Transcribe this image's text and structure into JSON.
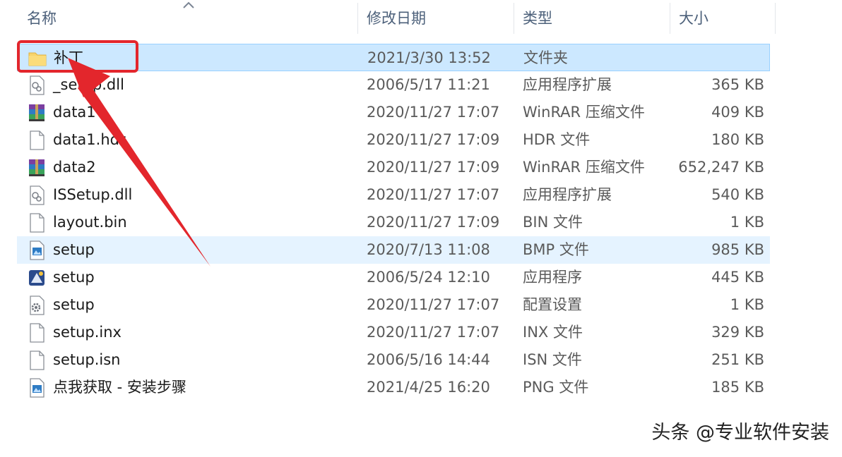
{
  "columns": {
    "name": "名称",
    "date": "修改日期",
    "type": "类型",
    "size": "大小"
  },
  "files": [
    {
      "name": "补丁",
      "date": "2021/3/30 13:52",
      "type": "文件夹",
      "size": "",
      "icon": "folder-icon"
    },
    {
      "name": "_setup.dll",
      "date": "2006/5/17 11:21",
      "type": "应用程序扩展",
      "size": "365 KB",
      "icon": "dll-file-icon"
    },
    {
      "name": "data1",
      "date": "2020/11/27 17:07",
      "type": "WinRAR 压缩文件",
      "size": "409 KB",
      "icon": "winrar-archive-icon"
    },
    {
      "name": "data1.hdr",
      "date": "2020/11/27 17:09",
      "type": "HDR 文件",
      "size": "180 KB",
      "icon": "blank-file-icon"
    },
    {
      "name": "data2",
      "date": "2020/11/27 17:09",
      "type": "WinRAR 压缩文件",
      "size": "652,247 KB",
      "icon": "winrar-archive-icon"
    },
    {
      "name": "ISSetup.dll",
      "date": "2020/11/27 17:07",
      "type": "应用程序扩展",
      "size": "540 KB",
      "icon": "dll-file-icon"
    },
    {
      "name": "layout.bin",
      "date": "2020/11/27 17:09",
      "type": "BIN 文件",
      "size": "1 KB",
      "icon": "blank-file-icon"
    },
    {
      "name": "setup",
      "date": "2020/7/13 11:08",
      "type": "BMP 文件",
      "size": "985 KB",
      "icon": "image-file-icon"
    },
    {
      "name": "setup",
      "date": "2006/5/24 12:10",
      "type": "应用程序",
      "size": "445 KB",
      "icon": "installer-app-icon"
    },
    {
      "name": "setup",
      "date": "2020/11/27 17:07",
      "type": "配置设置",
      "size": "1 KB",
      "icon": "settings-file-icon"
    },
    {
      "name": "setup.inx",
      "date": "2020/11/27 17:07",
      "type": "INX 文件",
      "size": "329 KB",
      "icon": "blank-file-icon"
    },
    {
      "name": "setup.isn",
      "date": "2006/5/16 14:44",
      "type": "ISN 文件",
      "size": "251 KB",
      "icon": "blank-file-icon"
    },
    {
      "name": "点我获取 - 安装步骤",
      "date": "2021/4/25 16:20",
      "type": "PNG 文件",
      "size": "185 KB",
      "icon": "image-file-icon"
    }
  ],
  "watermark": "头条 @专业软件安装",
  "colors": {
    "selection": "#cce8ff",
    "hover": "#e5f3ff",
    "annotation_red": "#e3262c"
  }
}
